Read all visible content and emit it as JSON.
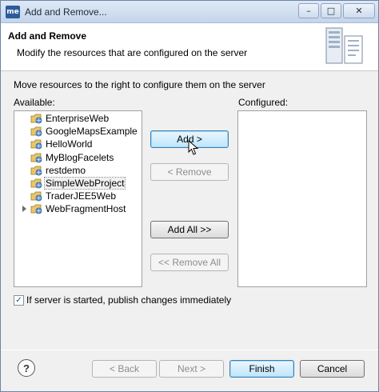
{
  "window": {
    "title": "Add and Remove...",
    "app_icon": "me",
    "minimize": "–",
    "maximize": "□",
    "close": "✕"
  },
  "banner": {
    "title": "Add and Remove",
    "description": "Modify the resources that are configured on the server"
  },
  "main": {
    "instructions": "Move resources to the right to configure them on the server",
    "available_label": "Available:",
    "configured_label": "Configured:",
    "available": [
      {
        "label": "EnterpriseWeb"
      },
      {
        "label": "GoogleMapsExample"
      },
      {
        "label": "HelloWorld"
      },
      {
        "label": "MyBlogFacelets"
      },
      {
        "label": "restdemo"
      },
      {
        "label": "SimpleWebProject"
      },
      {
        "label": "TraderJEE5Web"
      },
      {
        "label": "WebFragmentHost"
      }
    ],
    "configured": []
  },
  "buttons": {
    "add": "Add >",
    "remove": "< Remove",
    "add_all": "Add All >>",
    "remove_all": "<< Remove All"
  },
  "options": {
    "publish_label": "If server is started, publish changes immediately",
    "publish_checked": true,
    "check_glyph": "✓"
  },
  "footer": {
    "help": "?",
    "back": "< Back",
    "next": "Next >",
    "finish": "Finish",
    "cancel": "Cancel"
  },
  "colors": {
    "accent": "#3c7fb1",
    "titlebar": "#c4d5ea"
  }
}
